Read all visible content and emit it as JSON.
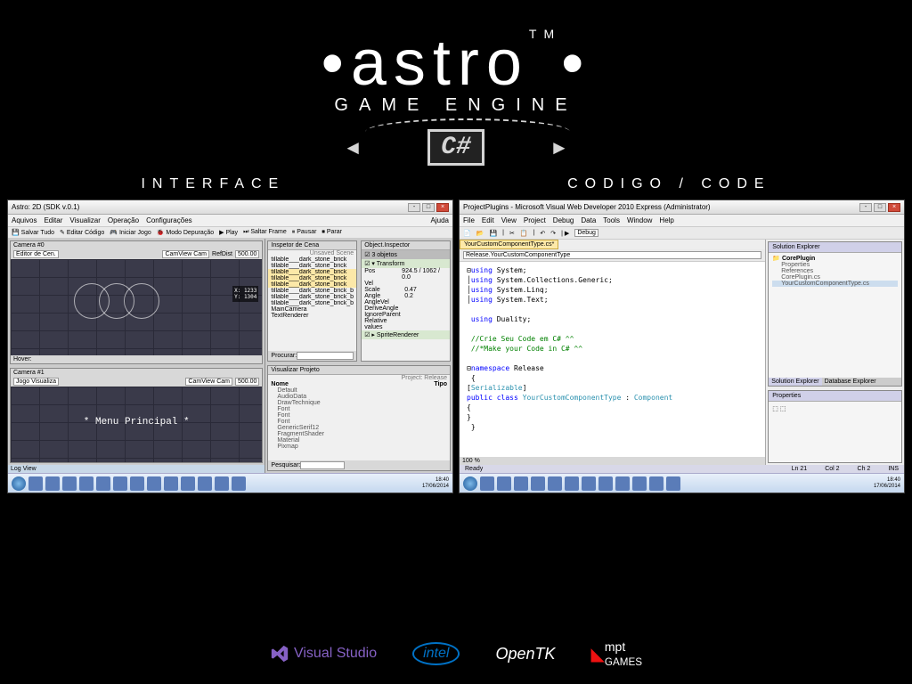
{
  "logo": {
    "text": "astro",
    "tm": "TM",
    "sub": "GAME ENGINE",
    "csharp": "C#"
  },
  "labels": {
    "left": "INTERFACE",
    "right": "CODIGO / CODE"
  },
  "astro": {
    "title": "Astro: 2D (SDK v.0.1)",
    "menu": [
      "Aquivos",
      "Editar",
      "Visualizar",
      "Operação",
      "Configurações"
    ],
    "toolbar": [
      "Salvar Tudo",
      "Editar Código",
      "Iniciar Jogo",
      "Modo Depuração",
      "Play",
      "Saltar Frame",
      "Pausar",
      "Parar"
    ],
    "help": "Ajuda",
    "cam0": {
      "title": "Camera #0",
      "editor": "Editor de Cen.",
      "camview": "CamView Cam",
      "refdist": "RefDist",
      "refdist_val": "500.00",
      "x": "X: 1233",
      "y": "Y: 1304",
      "hover": "Hover:"
    },
    "cam1": {
      "title": "Camera #1",
      "jogo": "Jogo Visualiza",
      "camview": "CamView Cam",
      "refdist_val": "500.00",
      "menu_text": "* Menu Principal *"
    },
    "scene": {
      "title": "Inspetor de Cena",
      "unsaved": "Unsaved Scene",
      "items": [
        "tillable___dark_stone_brick",
        "tillable___dark_stone_brick",
        "tillable___dark_stone_brick",
        "tillable___dark_stone_brick",
        "tillable___dark_stone_brick",
        "tillable___dark_stone_brick_b",
        "tillable___dark_stone_brick_b",
        "tillable___dark_stone_brick_b",
        "MainCamera",
        "TextRenderer"
      ],
      "procurar": "Procurar:"
    },
    "project": {
      "title": "Visualizar Projeto",
      "release": "Project: Release",
      "cols": [
        "Nome",
        "Tipo"
      ],
      "items": [
        "Default",
        "AudioData",
        "DrawTechnique",
        "Font",
        "Font",
        "Font",
        "GenericSerif12",
        "FragmentShader",
        "Material",
        "Pixmap"
      ],
      "pesquisar": "Pesquisar:"
    },
    "inspector": {
      "title": "Object.Inspector",
      "objcount": "3 objetos",
      "transform": "Transform",
      "sprite": "SpriteRenderer",
      "rows": [
        {
          "k": "Pos",
          "v": "924.5 / 1062 / 0.0"
        },
        {
          "k": "Vel",
          "v": ""
        },
        {
          "k": "Scale",
          "v": "0.47"
        },
        {
          "k": "Angle",
          "v": "0.2"
        },
        {
          "k": "AngleVel",
          "v": ""
        },
        {
          "k": "DeriveAngle",
          "v": ""
        },
        {
          "k": "IgnoreParent",
          "v": ""
        },
        {
          "k": "Relative values",
          "v": ""
        }
      ]
    },
    "logview": "Log View"
  },
  "vs": {
    "title": "ProjectPlugins - Microsoft Visual Web Developer 2010 Express (Administrator)",
    "menu": [
      "File",
      "Edit",
      "View",
      "Project",
      "Debug",
      "Data",
      "Tools",
      "Window",
      "Help"
    ],
    "config": "Debug",
    "tab": "YourCustomComponentType.cs*",
    "dropdown": "Release.YourCustomComponentType",
    "code": {
      "l1": "using",
      "l1b": " System;",
      "l2": "using",
      "l2b": " System.Collections.Generic;",
      "l3": "using",
      "l3b": " System.Linq;",
      "l4": "using",
      "l4b": " System.Text;",
      "l5": "using",
      "l5b": " Duality;",
      "c1": "//Crie Seu Code  em C# ^^",
      "c2": "//*Make your Code in C# ^^",
      "l6": "namespace",
      "l6b": " Release",
      "lb": "{",
      "l7a": "    [",
      "l7b": "Serializable",
      "l7c": "]",
      "l8a": "    public class ",
      "l8b": "YourCustomComponentType",
      "l8c": " : ",
      "l8d": "Component",
      "l9": "    {",
      "l10": "    }",
      "rb": "}",
      "pct": "100 %"
    },
    "solution": {
      "title": "Solution Explorer",
      "root": "CorePlugin",
      "items": [
        "Properties",
        "References",
        "CorePlugin.cs",
        "YourCustomComponentType.cs"
      ],
      "tabs": [
        "Solution Explorer",
        "Database Explorer"
      ]
    },
    "props": {
      "title": "Properties"
    },
    "status": {
      "ready": "Ready",
      "ln": "Ln 21",
      "col": "Col 2",
      "ch": "Ch 2",
      "ins": "INS"
    }
  },
  "taskbar": {
    "time": "18:40",
    "date": "17/06/2014"
  },
  "footer": {
    "vs": "Visual Studio",
    "intel": "intel",
    "opentk": "OpenTK",
    "mpt": "mpt",
    "games": "GAMES"
  }
}
